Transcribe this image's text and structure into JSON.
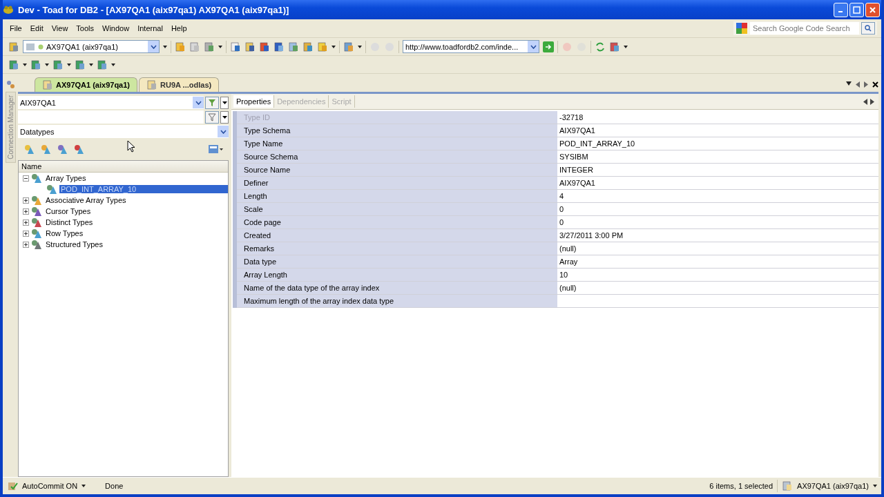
{
  "window": {
    "title": "Dev - Toad for DB2 - [AX97QA1 (aix97qa1) AX97QA1 (aix97qa1)]"
  },
  "menu": [
    "File",
    "Edit",
    "View",
    "Tools",
    "Window",
    "Internal",
    "Help"
  ],
  "toolbar": {
    "connection": "AX97QA1 (aix97qa1)",
    "url": "http://www.toadfordb2.com/inde...",
    "search": {
      "placeholder": "Search Google Code Search"
    }
  },
  "side_strip": {
    "label": "Connection Manager"
  },
  "doc_tabs": [
    {
      "label": "AX97QA1 (aix97qa1)",
      "selected": true
    },
    {
      "label": "RU9A ...odlas)",
      "selected": false
    }
  ],
  "explorer": {
    "schema": "AIX97QA1",
    "object_type": "Datatypes",
    "column": "Name",
    "tree": [
      {
        "label": "Array Types",
        "expanded": true,
        "color": "#4a9fd0",
        "children": [
          {
            "label": "POD_INT_ARRAY_10",
            "selected": true
          }
        ]
      },
      {
        "label": "Associative Array Types",
        "expanded": false,
        "color": "#e8a838"
      },
      {
        "label": "Cursor Types",
        "expanded": false,
        "color": "#7a5ab8"
      },
      {
        "label": "Distinct Types",
        "expanded": false,
        "color": "#c84850"
      },
      {
        "label": "Row Types",
        "expanded": false,
        "color": "#4a9fd0"
      },
      {
        "label": "Structured Types",
        "expanded": false,
        "color": "#707878"
      }
    ]
  },
  "details": {
    "tabs": [
      {
        "label": "Properties",
        "selected": true,
        "disabled": false
      },
      {
        "label": "Dependencies",
        "selected": false,
        "disabled": true
      },
      {
        "label": "Script",
        "selected": false,
        "disabled": true
      }
    ],
    "properties": [
      {
        "name": "Type ID",
        "value": "-32718",
        "disabled": true
      },
      {
        "name": "Type Schema",
        "value": "AIX97QA1",
        "disabled": false
      },
      {
        "name": "Type Name",
        "value": "POD_INT_ARRAY_10",
        "disabled": false
      },
      {
        "name": "Source Schema",
        "value": "SYSIBM",
        "disabled": false
      },
      {
        "name": "Source Name",
        "value": "INTEGER",
        "disabled": false
      },
      {
        "name": "Definer",
        "value": "AIX97QA1",
        "disabled": false
      },
      {
        "name": "Length",
        "value": "4",
        "disabled": false
      },
      {
        "name": "Scale",
        "value": "0",
        "disabled": false
      },
      {
        "name": "Code page",
        "value": "0",
        "disabled": false
      },
      {
        "name": "Created",
        "value": "3/27/2011 3:00 PM",
        "disabled": false
      },
      {
        "name": "Remarks",
        "value": "(null)",
        "disabled": false
      },
      {
        "name": "Data type",
        "value": "Array",
        "disabled": false
      },
      {
        "name": "Array Length",
        "value": "10",
        "disabled": false
      },
      {
        "name": "Name of the data type of the array index",
        "value": "(null)",
        "disabled": false
      },
      {
        "name": "Maximum length of the array index data type",
        "disabled": false
      }
    ]
  },
  "status_bar": {
    "autocommit": "AutoCommit ON",
    "status": "Done",
    "summary": "6 items, 1 selected",
    "connection": "AX97QA1 (aix97qa1)"
  }
}
